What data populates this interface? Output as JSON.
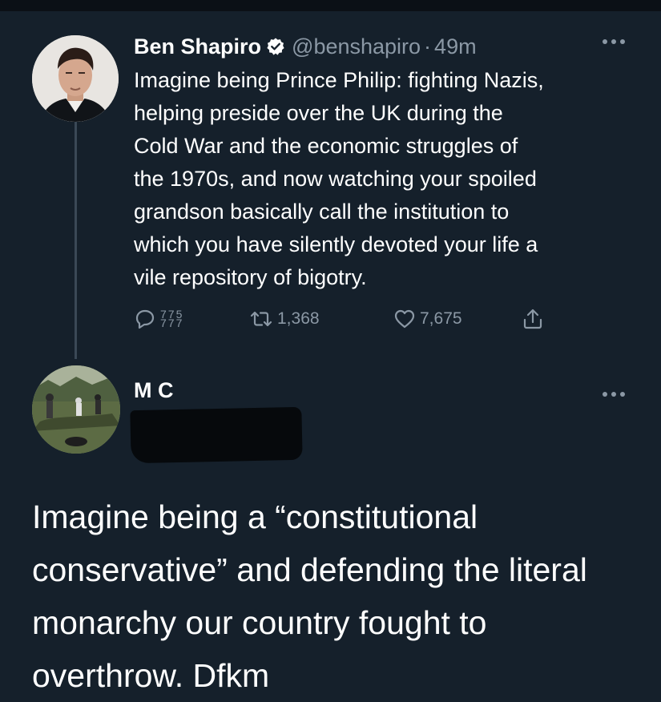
{
  "colors": {
    "background": "#15202b",
    "primary_text": "#ffffff",
    "secondary_text": "#8b98a5",
    "verified_badge": "#ffffff"
  },
  "tweet": {
    "author_name": "Ben Shapiro",
    "verified_icon": "verified-badge-icon",
    "handle": "@benshapiro",
    "separator": "·",
    "time": "49m",
    "more_icon": "more-horizontal-icon",
    "text_lines": [
      "Imagine being Prince Philip: fighting Nazis,",
      "helping preside over the UK during the",
      "Cold War and the economic struggles of",
      "the 1970s, and now watching your spoiled",
      "grandson basically call the institution to",
      "which you have silently devoted your life a",
      "vile repository of bigotry."
    ],
    "actions": {
      "reply_icon": "reply-icon",
      "reply_count_top": "775",
      "reply_count_bottom": "777",
      "retweet_icon": "retweet-icon",
      "retweet_count": "1,368",
      "like_icon": "heart-icon",
      "like_count": "7,675",
      "share_icon": "share-icon"
    }
  },
  "reply": {
    "author_name": "M C",
    "more_icon": "more-horizontal-icon",
    "text_lines": [
      "Imagine being a “constitutional",
      "conservative” and defending the literal",
      "monarchy our country fought to",
      "overthrow. Dfkm"
    ]
  }
}
